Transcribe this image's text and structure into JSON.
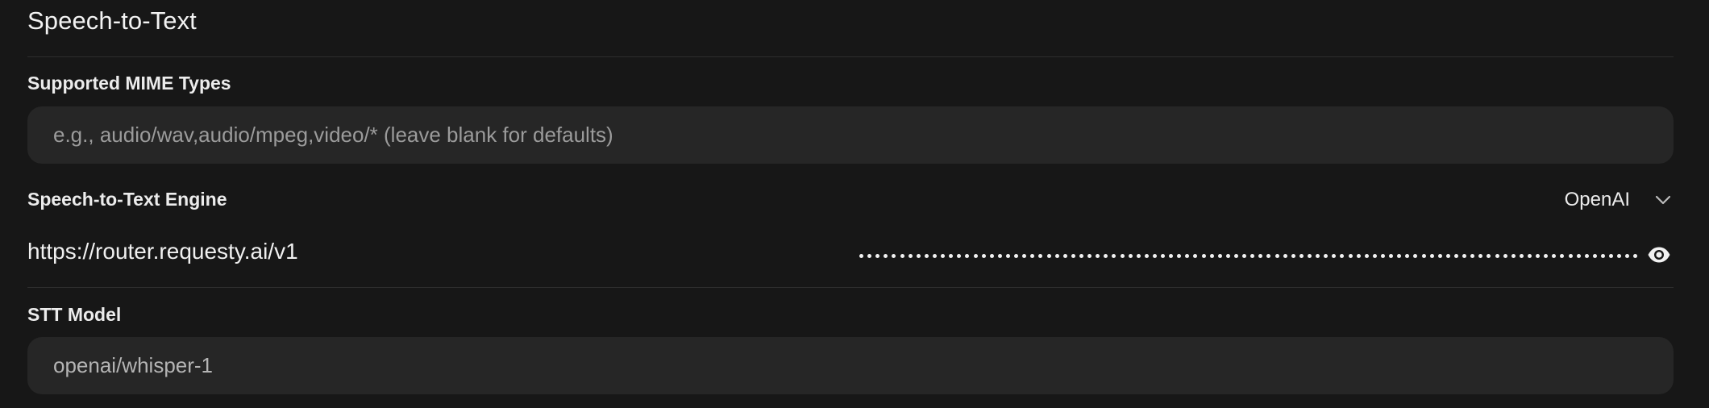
{
  "section": {
    "title": "Speech-to-Text"
  },
  "mime_types": {
    "label": "Supported MIME Types",
    "value": "",
    "placeholder": "e.g., audio/wav,audio/mpeg,video/* (leave blank for defaults)"
  },
  "engine": {
    "label": "Speech-to-Text Engine",
    "selected": "OpenAI",
    "icon": "chevron-down-icon"
  },
  "api": {
    "base_url": "https://router.requesty.ai/v1",
    "key_masked": true,
    "key_dot_count": 96,
    "toggle_icon": "eye-icon"
  },
  "model": {
    "label": "STT Model",
    "value": "openai/whisper-1"
  },
  "colors": {
    "background": "#171717",
    "field_background": "#262626",
    "divider": "#2e2e2e",
    "text": "#ececec",
    "placeholder": "#9b9b9b"
  }
}
